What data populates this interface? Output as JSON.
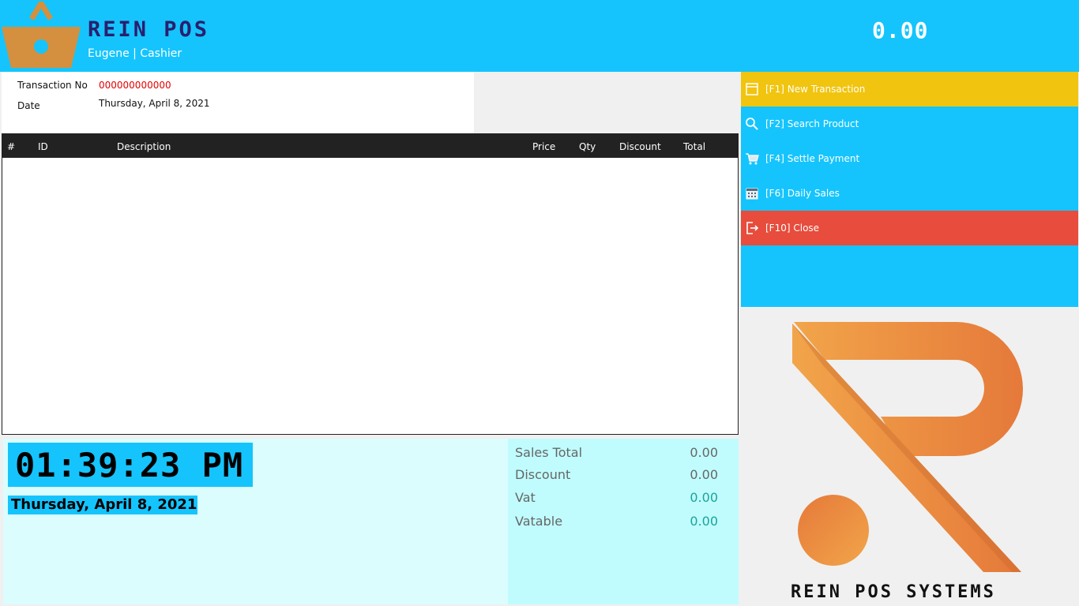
{
  "header": {
    "app_title": "REIN POS",
    "user_line": "Eugene | Cashier",
    "grand_total": "0.00"
  },
  "transaction": {
    "no_label": "Transaction No",
    "no_value": "000000000000",
    "date_label": "Date",
    "date_value": "Thursday, April 8, 2021"
  },
  "cart": {
    "columns": [
      "#",
      "ID",
      "Description",
      "Price",
      "Qty",
      "Discount",
      "Total"
    ],
    "rows": []
  },
  "clock": {
    "time": "01:39:23 PM",
    "date": "Thursday, April 8, 2021"
  },
  "totals": {
    "sales_total_label": "Sales Total",
    "sales_total_value": "0.00",
    "discount_label": "Discount",
    "discount_value": "0.00",
    "vat_label": "Vat",
    "vat_value": "0.00",
    "vatable_label": "Vatable",
    "vatable_value": "0.00"
  },
  "menu": {
    "items": [
      {
        "label": "[F1] New Transaction",
        "icon": "window-icon",
        "color": "#f1c40f"
      },
      {
        "label": "[F2] Search Product",
        "icon": "search-icon",
        "color": "#15c4fd"
      },
      {
        "label": "[F4] Settle Payment",
        "icon": "cart-icon",
        "color": "#15c4fd"
      },
      {
        "label": "[F6] Daily Sales",
        "icon": "calendar-icon",
        "color": "#15c4fd"
      },
      {
        "label": "[F10] Close",
        "icon": "exit-icon",
        "color": "#e74c3c"
      }
    ]
  },
  "brand": {
    "name": "REIN POS SYSTEMS"
  },
  "colors": {
    "accent": "#15c4fd",
    "logo_orange": "#e8883a"
  }
}
